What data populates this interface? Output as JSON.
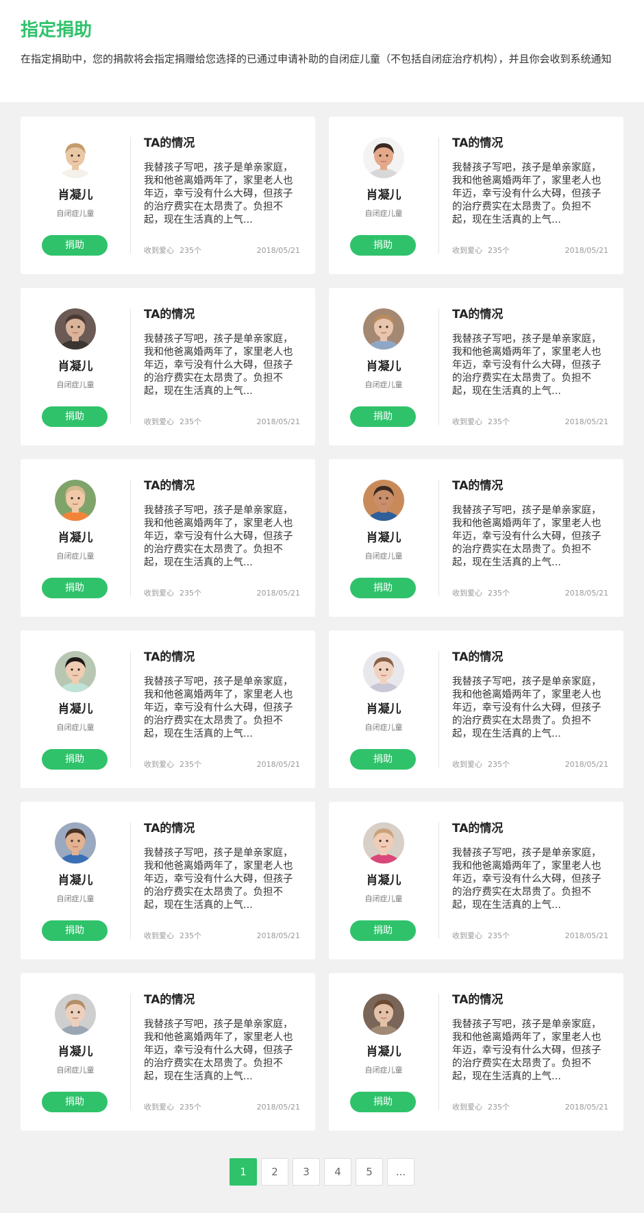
{
  "header": {
    "title": "指定捐助",
    "description": "在指定捐助中，您的捐款将会指定捐赠给您选择的已通过申请补助的自闭症儿童（不包括自闭症治疗机构），并且你会收到系统通知"
  },
  "cards": [
    {
      "name": "肖凝儿",
      "tag": "自闭症儿童",
      "button": "捐助",
      "title": "TA的情况",
      "story": "我替孩子写吧，孩子是单亲家庭，我和他爸离婚两年了，家里老人也年迈，幸亏没有什么大碍，但孩子的治疗费实在太昂贵了。负担不起，现在生活真的上气...",
      "love_label": "收到爱心",
      "love_count": "235个",
      "date": "2018/05/21",
      "avatar_colors": {
        "bg": "#ffffff",
        "skin": "#e9c8a6",
        "hair": "#c59b6b",
        "shirt": "#f4f1ea"
      }
    },
    {
      "name": "肖凝儿",
      "tag": "自闭症儿童",
      "button": "捐助",
      "title": "TA的情况",
      "story": "我替孩子写吧，孩子是单亲家庭，我和他爸离婚两年了，家里老人也年迈，幸亏没有什么大碍，但孩子的治疗费实在太昂贵了。负担不起，现在生活真的上气...",
      "love_label": "收到爱心",
      "love_count": "235个",
      "date": "2018/05/21",
      "avatar_colors": {
        "bg": "#f3f3f3",
        "skin": "#e3a98a",
        "hair": "#3a2a22",
        "shirt": "#d8d8d8"
      }
    },
    {
      "name": "肖凝儿",
      "tag": "自闭症儿童",
      "button": "捐助",
      "title": "TA的情况",
      "story": "我替孩子写吧，孩子是单亲家庭，我和他爸离婚两年了，家里老人也年迈，幸亏没有什么大碍，但孩子的治疗费实在太昂贵了。负担不起，现在生活真的上气...",
      "love_label": "收到爱心",
      "love_count": "235个",
      "date": "2018/05/21",
      "avatar_colors": {
        "bg": "#6b5a55",
        "skin": "#d9b39a",
        "hair": "#4a3a33",
        "shirt": "#3c3633"
      }
    },
    {
      "name": "肖凝儿",
      "tag": "自闭症儿童",
      "button": "捐助",
      "title": "TA的情况",
      "story": "我替孩子写吧，孩子是单亲家庭，我和他爸离婚两年了，家里老人也年迈，幸亏没有什么大碍，但孩子的治疗费实在太昂贵了。负担不起，现在生活真的上气...",
      "love_label": "收到爱心",
      "love_count": "235个",
      "date": "2018/05/21",
      "avatar_colors": {
        "bg": "#a58872",
        "skin": "#e8c5ad",
        "hair": "#b98b5e",
        "shirt": "#8fa7c6"
      }
    },
    {
      "name": "肖凝儿",
      "tag": "自闭症儿童",
      "button": "捐助",
      "title": "TA的情况",
      "story": "我替孩子写吧，孩子是单亲家庭，我和他爸离婚两年了，家里老人也年迈，幸亏没有什么大碍，但孩子的治疗费实在太昂贵了。负担不起，现在生活真的上气...",
      "love_label": "收到爱心",
      "love_count": "235个",
      "date": "2018/05/21",
      "avatar_colors": {
        "bg": "#7fa46a",
        "skin": "#f0c9a8",
        "hair": "#d6b98f",
        "shirt": "#f2843a"
      }
    },
    {
      "name": "肖凝儿",
      "tag": "自闭症儿童",
      "button": "捐助",
      "title": "TA的情况",
      "story": "我替孩子写吧，孩子是单亲家庭，我和他爸离婚两年了，家里老人也年迈，幸亏没有什么大碍，但孩子的治疗费实在太昂贵了。负担不起，现在生活真的上气...",
      "love_label": "收到爱心",
      "love_count": "235个",
      "date": "2018/05/21",
      "avatar_colors": {
        "bg": "#c98a5a",
        "skin": "#c98f6b",
        "hair": "#3b2a22",
        "shirt": "#2f5f9a"
      }
    },
    {
      "name": "肖凝儿",
      "tag": "自闭症儿童",
      "button": "捐助",
      "title": "TA的情况",
      "story": "我替孩子写吧，孩子是单亲家庭，我和他爸离婚两年了，家里老人也年迈，幸亏没有什么大碍，但孩子的治疗费实在太昂贵了。负担不起，现在生活真的上气...",
      "love_label": "收到爱心",
      "love_count": "235个",
      "date": "2018/05/21",
      "avatar_colors": {
        "bg": "#b7c7b2",
        "skin": "#efcdb2",
        "hair": "#1e1a18",
        "shirt": "#bfe3d6"
      }
    },
    {
      "name": "肖凝儿",
      "tag": "自闭症儿童",
      "button": "捐助",
      "title": "TA的情况",
      "story": "我替孩子写吧，孩子是单亲家庭，我和他爸离婚两年了，家里老人也年迈，幸亏没有什么大碍，但孩子的治疗费实在太昂贵了。负担不起，现在生活真的上气...",
      "love_label": "收到爱心",
      "love_count": "235个",
      "date": "2018/05/21",
      "avatar_colors": {
        "bg": "#e8e8ec",
        "skin": "#f0d2bf",
        "hair": "#8a6146",
        "shirt": "#c9c6d8"
      }
    },
    {
      "name": "肖凝儿",
      "tag": "自闭症儿童",
      "button": "捐助",
      "title": "TA的情况",
      "story": "我替孩子写吧，孩子是单亲家庭，我和他爸离婚两年了，家里老人也年迈，幸亏没有什么大碍，但孩子的治疗费实在太昂贵了。负担不起，现在生活真的上气...",
      "love_label": "收到爱心",
      "love_count": "235个",
      "date": "2018/05/21",
      "avatar_colors": {
        "bg": "#9aa9c0",
        "skin": "#e2b291",
        "hair": "#4a3222",
        "shirt": "#3b6fb5"
      }
    },
    {
      "name": "肖凝儿",
      "tag": "自闭症儿童",
      "button": "捐助",
      "title": "TA的情况",
      "story": "我替孩子写吧，孩子是单亲家庭，我和他爸离婚两年了，家里老人也年迈，幸亏没有什么大碍，但孩子的治疗费实在太昂贵了。负担不起，现在生活真的上气...",
      "love_label": "收到爱心",
      "love_count": "235个",
      "date": "2018/05/21",
      "avatar_colors": {
        "bg": "#d8cfc6",
        "skin": "#f1cdb7",
        "hair": "#caa27a",
        "shirt": "#d9477a"
      }
    },
    {
      "name": "肖凝儿",
      "tag": "自闭症儿童",
      "button": "捐助",
      "title": "TA的情况",
      "story": "我替孩子写吧，孩子是单亲家庭，我和他爸离婚两年了，家里老人也年迈，幸亏没有什么大碍，但孩子的治疗费实在太昂贵了。负担不起，现在生活真的上气...",
      "love_label": "收到爱心",
      "love_count": "235个",
      "date": "2018/05/21",
      "avatar_colors": {
        "bg": "#cfcfcf",
        "skin": "#ecd0bc",
        "hair": "#b58d68",
        "shirt": "#9aa6b4"
      }
    },
    {
      "name": "肖凝儿",
      "tag": "自闭症儿童",
      "button": "捐助",
      "title": "TA的情况",
      "story": "我替孩子写吧，孩子是单亲家庭，我和他爸离婚两年了，家里老人也年迈，幸亏没有什么大碍，但孩子的治疗费实在太昂贵了。负担不起，现在生活真的上气...",
      "love_label": "收到爱心",
      "love_count": "235个",
      "date": "2018/05/21",
      "avatar_colors": {
        "bg": "#7a6658",
        "skin": "#e3c1a8",
        "hair": "#6b4a34",
        "shirt": "#a08a76"
      }
    }
  ],
  "pagination": {
    "pages": [
      "1",
      "2",
      "3",
      "4",
      "5",
      "..."
    ],
    "active": "1"
  },
  "colors": {
    "accent": "#2fc26b"
  }
}
